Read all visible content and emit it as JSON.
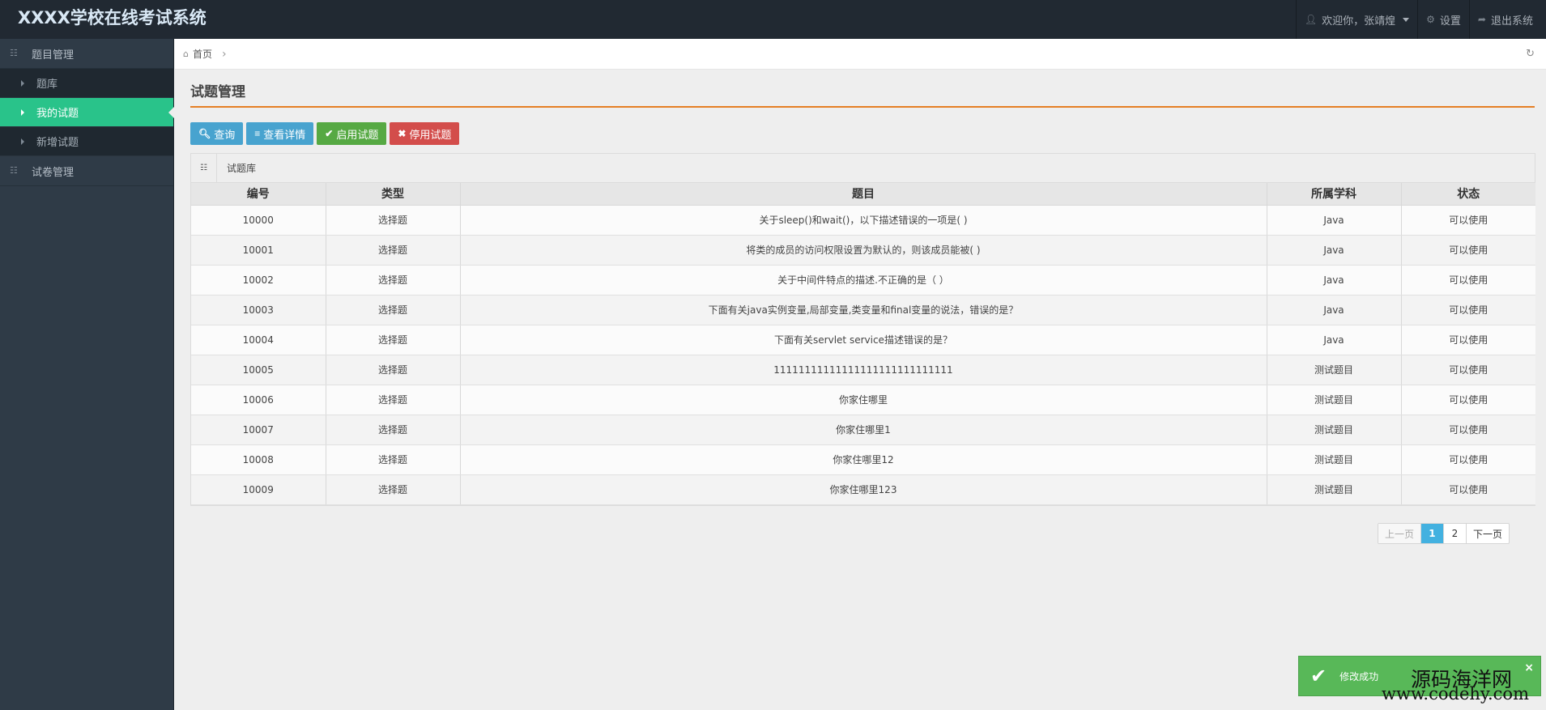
{
  "app": {
    "title": "XXXX学校在线考试系统"
  },
  "navbar": {
    "welcome": "欢迎你，张靖煌",
    "settings": "设置",
    "logout": "退出系统"
  },
  "sidebar": {
    "groups": [
      {
        "label": "题目管理",
        "items": [
          {
            "label": "题库"
          },
          {
            "label": "我的试题"
          },
          {
            "label": "新增试题"
          }
        ]
      },
      {
        "label": "试卷管理"
      }
    ]
  },
  "breadcrumb": {
    "home": "首页"
  },
  "page": {
    "title": "试题管理"
  },
  "toolbar": {
    "query": "查询",
    "details": "查看详情",
    "enable": "启用试题",
    "disable": "停用试题"
  },
  "table": {
    "caption": "试题库",
    "columns": [
      "编号",
      "类型",
      "题目",
      "所属学科",
      "状态"
    ],
    "rows": [
      [
        "10000",
        "选择题",
        "关于sleep()和wait()，以下描述错误的一项是( )",
        "Java",
        "可以使用"
      ],
      [
        "10001",
        "选择题",
        "将类的成员的访问权限设置为默认的，则该成员能被( )",
        "Java",
        "可以使用"
      ],
      [
        "10002",
        "选择题",
        "关于中间件特点的描述.不正确的是（ ）",
        "Java",
        "可以使用"
      ],
      [
        "10003",
        "选择题",
        "下面有关java实例变量,局部变量,类变量和final变量的说法，错误的是？",
        "Java",
        "可以使用"
      ],
      [
        "10004",
        "选择题",
        "下面有关servlet service描述错误的是？",
        "Java",
        "可以使用"
      ],
      [
        "10005",
        "选择题",
        "11111111111111111111111111111",
        "测试题目",
        "可以使用"
      ],
      [
        "10006",
        "选择题",
        "你家住哪里",
        "测试题目",
        "可以使用"
      ],
      [
        "10007",
        "选择题",
        "你家住哪里1",
        "测试题目",
        "可以使用"
      ],
      [
        "10008",
        "选择题",
        "你家住哪里12",
        "测试题目",
        "可以使用"
      ],
      [
        "10009",
        "选择题",
        "你家住哪里123",
        "测试题目",
        "可以使用"
      ]
    ]
  },
  "pager": {
    "prev": "上一页",
    "pages": [
      "1",
      "2"
    ],
    "current": "1",
    "next": "下一页"
  },
  "toast": {
    "message": "修改成功",
    "close": "×"
  },
  "watermark": {
    "line1": "源码海洋网",
    "line2": "www.codehy.com"
  },
  "icons": {
    "user": "user-icon",
    "gear": "gear-icon",
    "logout": "logout-icon",
    "home": "home-icon",
    "refresh": "refresh-icon",
    "search": "search-icon",
    "list": "list-icon",
    "check": "check-icon",
    "times": "times-icon"
  },
  "colors": {
    "navbar": "#212932",
    "sidebar": "#2f3b47",
    "active": "#29c38a",
    "accent_line": "#e57e24",
    "info": "#48a3cf",
    "success": "#56a943",
    "danger": "#d34d4b",
    "toast": "#58b858",
    "page_current": "#43b1e0"
  }
}
